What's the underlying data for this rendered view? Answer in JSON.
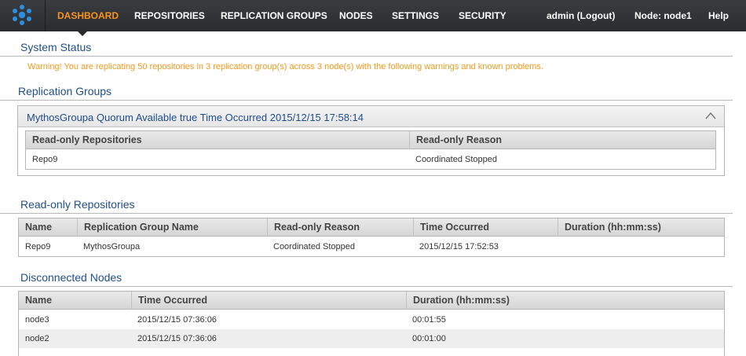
{
  "nav": {
    "items": [
      {
        "label": "DASHBOARD",
        "active": true
      },
      {
        "label": "REPOSITORIES"
      },
      {
        "label": "REPLICATION GROUPS"
      },
      {
        "label": "NODES"
      },
      {
        "label": "SETTINGS"
      },
      {
        "label": "SECURITY"
      }
    ],
    "user": "admin (Logout)",
    "node": "Node: node1",
    "help": "Help",
    "accent_color": "#f7931e"
  },
  "system_status": {
    "title": "System Status",
    "warning": "Warning! You are replicating 50 repositories in 3 replication group(s) across 3 node(s) with the following warnings and known problems."
  },
  "replication_groups": {
    "title": "Replication Groups",
    "group_header": "MythosGroupa Quorum Available true Time Occurred 2015/12/15 17:58:14",
    "collapse_icon": "chevron-up-icon",
    "columns": [
      "Read-only Repositories",
      "Read-only Reason"
    ],
    "rows": [
      [
        "Repo9",
        "Coordinated Stopped"
      ]
    ]
  },
  "readonly_repositories": {
    "title": "Read-only Repositories",
    "columns": [
      "Name",
      "Replication Group Name",
      "Read-only Reason",
      "Time Occurred",
      "Duration (hh:mm:ss)"
    ],
    "rows": [
      [
        "Repo9",
        "MythosGroupa",
        "Coordinated Stopped",
        "2015/12/15 17:52:53",
        ""
      ]
    ]
  },
  "disconnected_nodes": {
    "title": "Disconnected Nodes",
    "columns": [
      "Name",
      "Time Occurred",
      "Duration (hh:mm:ss)"
    ],
    "rows": [
      [
        "node3",
        "2015/12/15 07:36:06",
        "00:01:55"
      ],
      [
        "node2",
        "2015/12/15 07:36:06",
        "00:01:00"
      ]
    ]
  }
}
